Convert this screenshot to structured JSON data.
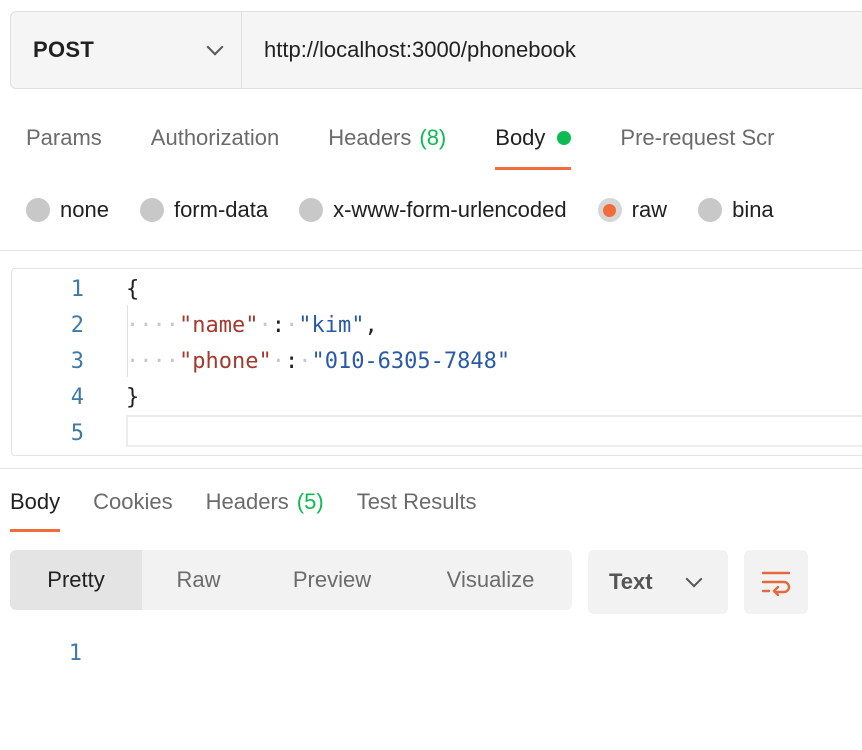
{
  "request": {
    "method": "POST",
    "url": "http://localhost:3000/phonebook"
  },
  "request_tabs": [
    {
      "label": "Params"
    },
    {
      "label": "Authorization"
    },
    {
      "label": "Headers",
      "count": "(8)"
    },
    {
      "label": "Body",
      "active": true,
      "indicator": "green-dot"
    },
    {
      "label": "Pre-request Scr"
    }
  ],
  "body_types": [
    {
      "label": "none"
    },
    {
      "label": "form-data"
    },
    {
      "label": "x-www-form-urlencoded"
    },
    {
      "label": "raw",
      "selected": true
    },
    {
      "label": "bina"
    }
  ],
  "editor": {
    "line_numbers": [
      "1",
      "2",
      "3",
      "4",
      "5"
    ],
    "line1": "{",
    "line2_key": "\"name\"",
    "line2_colon": ":",
    "line2_value": "\"kim\"",
    "line2_comma": ",",
    "line3_key": "\"phone\"",
    "line3_colon": ":",
    "line3_value": "\"010-6305-7848\"",
    "line4": "}"
  },
  "response_tabs": [
    {
      "label": "Body",
      "active": true
    },
    {
      "label": "Cookies"
    },
    {
      "label": "Headers",
      "count": "(5)"
    },
    {
      "label": "Test Results"
    }
  ],
  "view_modes": [
    {
      "label": "Pretty",
      "active": true
    },
    {
      "label": "Raw"
    },
    {
      "label": "Preview"
    },
    {
      "label": "Visualize"
    }
  ],
  "format_select": {
    "value": "Text",
    "icon": "chevron-down-icon"
  },
  "wrap_button": {
    "icon": "wrap-lines-icon"
  },
  "response": {
    "line_number": "1"
  },
  "colors": {
    "accent": "#f26b3a",
    "success": "#0cbb52",
    "json_key": "#a33a2f",
    "json_string": "#2a5aa6",
    "line_number": "#3e7aa6"
  }
}
